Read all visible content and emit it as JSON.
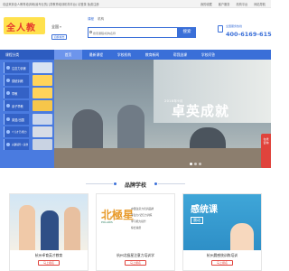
{
  "topbar": {
    "welcome": "欢迎来到全人教育培训网(最专业的儿童教育培训机构平台) 请登录 免费注册",
    "links": [
      "我的收藏",
      "客户服务",
      "机构平台",
      "网站导航"
    ]
  },
  "header": {
    "logo_text": "全人教",
    "city": "全国",
    "switch_city": "切换城市",
    "search_tabs": [
      "课程",
      "机构"
    ],
    "search_placeholder": "搜索课程/机构名称",
    "search_button": "搜索",
    "hotline_label": "全国服务热线",
    "hotline": "400-6169-615"
  },
  "nav": {
    "category_label": "课程分类",
    "items": [
      "首页",
      "最新课程",
      "学校机构",
      "教育新闻",
      "帮我选课",
      "学校问答"
    ],
    "active_index": 0
  },
  "side_menu": [
    "注意力训练",
    "感统训练",
    "早教",
    "亲子早教",
    "英语/出国",
    "少儿才艺/能力",
    "兴趣辅导 / 其他"
  ],
  "banner": {
    "year": "2018年9月",
    "slogan": "卓英成就"
  },
  "float_right": "在线咨询",
  "section": {
    "title": "品牌学校"
  },
  "cards": [
    {
      "name": "杭州卓育英才教育",
      "button": "马上报名"
    },
    {
      "name": "杭州北极星注意力培训学",
      "button": "马上报名",
      "brand": "北極星",
      "brand_sub": "POLARIS",
      "lines": [
        "中国注意力培训品牌",
        "专注力/记忆力训练",
        "学习能力提升",
        "综合素质"
      ]
    },
    {
      "name": "杭州晨感统训练培训",
      "button": "马上报名",
      "brand": "感统课",
      "brand_sub": "晨动"
    }
  ]
}
